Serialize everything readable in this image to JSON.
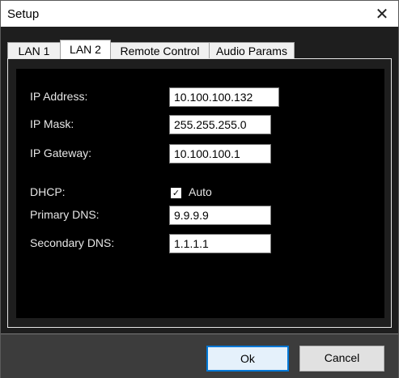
{
  "window": {
    "title": "Setup",
    "close_glyph": "✕"
  },
  "tabs": [
    {
      "label": "LAN 1"
    },
    {
      "label": "LAN 2"
    },
    {
      "label": "Remote Control"
    },
    {
      "label": "Audio Params"
    }
  ],
  "active_tab": "LAN 2",
  "form": {
    "ip_address": {
      "label": "IP Address:",
      "value": "10.100.100.132"
    },
    "ip_mask": {
      "label": "IP Mask:",
      "value": "255.255.255.0"
    },
    "ip_gateway": {
      "label": "IP Gateway:",
      "value": "10.100.100.1"
    },
    "dhcp": {
      "label": "DHCP:",
      "checkbox_label": "Auto",
      "checked": true,
      "check_glyph": "✓"
    },
    "primary_dns": {
      "label": "Primary DNS:",
      "value": "9.9.9.9"
    },
    "secondary_dns": {
      "label": "Secondary DNS:",
      "value": "1.1.1.1"
    }
  },
  "buttons": {
    "ok_label": "Ok",
    "cancel_label": "Cancel"
  },
  "colors": {
    "accent": "#0078d7",
    "panel_bg": "#000000",
    "footer_bg": "#3c3c3c"
  }
}
